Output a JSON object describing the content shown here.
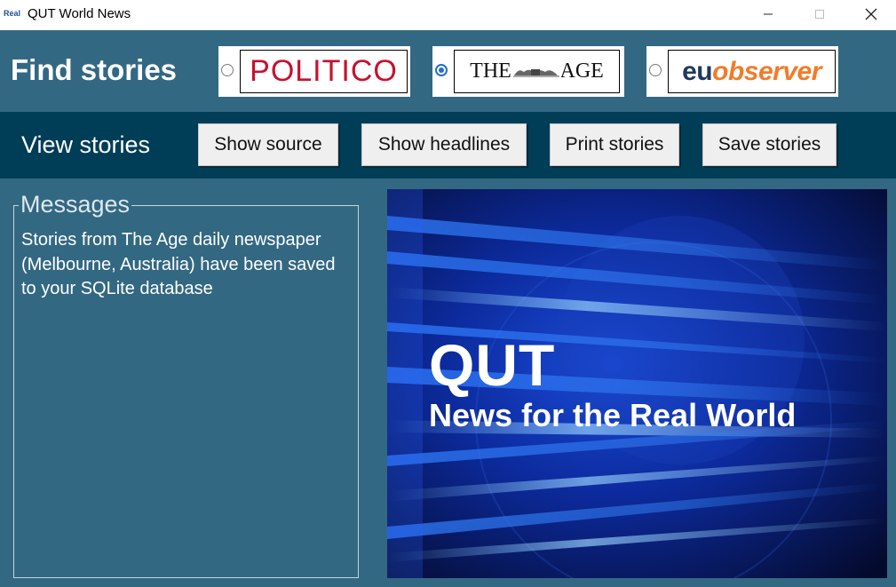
{
  "window": {
    "icon_text": "Real",
    "title": "QUT World News"
  },
  "find": {
    "label": "Find stories",
    "sources": [
      {
        "name": "POLITICO",
        "selected": false
      },
      {
        "name": "THE AGE",
        "selected": true
      },
      {
        "name_part1": "eu",
        "name_part2": "observer",
        "selected": false
      }
    ]
  },
  "view": {
    "label": "View stories",
    "buttons": {
      "show_source": "Show source",
      "show_headlines": "Show headlines",
      "print_stories": "Print stories",
      "save_stories": "Save stories"
    }
  },
  "messages": {
    "legend": "Messages",
    "text": "Stories from The Age daily newspaper (Melbourne, Australia) have been saved to your SQLite database"
  },
  "banner": {
    "title": "QUT",
    "subtitle": "News for the Real World"
  },
  "colors": {
    "window_bg": "#336882",
    "view_band": "#003d57",
    "politico_red": "#c8102e",
    "eu_navy": "#1e3a5f",
    "eu_orange": "#f07c2a",
    "radio_selected": "#1f6fd0"
  }
}
